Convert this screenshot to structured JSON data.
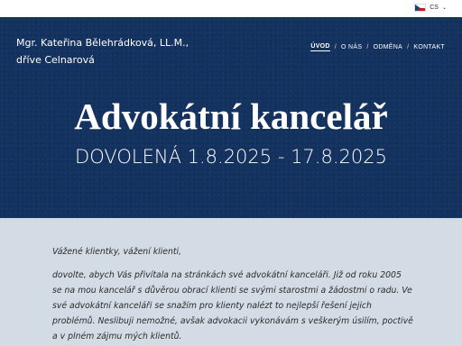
{
  "language": {
    "code": "CS",
    "flag_icon": "czech-flag-icon",
    "chevron_icon": "chevron-down-icon"
  },
  "header": {
    "site_name": "Mgr. Kateřina Bělehrádková, LL.M.,  dříve Celnarová",
    "nav": [
      {
        "label": "ÚVOD",
        "active": true
      },
      {
        "label": "O NÁS",
        "active": false
      },
      {
        "label": "ODMĚNA",
        "active": false
      },
      {
        "label": "KONTAKT",
        "active": false
      }
    ],
    "nav_separator": "/"
  },
  "hero": {
    "title": "Advokátní kancelář",
    "subtitle": "DOVOLENÁ 1.8.2025 - 17.8.2025"
  },
  "content": {
    "greeting": "Vážené klientky, vážení klienti,",
    "body": "dovolte, abych Vás přivítala na stránkách své advokátní kanceláři. Již od roku 2005 se na mou kancelář s důvěrou obrací klienti se svými starostmi a žádostmi o radu. Ve své advokátní kanceláři se snažím pro klienty nalézt to nejlepší řešení jejich problémů. Neslibuji nemožné, avšak advokacii vykonávám s veškerým úsilím, poctivě a v plném zájmu mých klientů."
  },
  "colors": {
    "hero_bg": "#14325f",
    "content_bg": "#d3dce4",
    "text": "#2b2b2b"
  }
}
